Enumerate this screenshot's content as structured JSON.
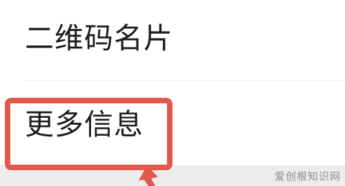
{
  "rows": [
    {
      "label": "二维码名片"
    },
    {
      "label": "更多信息"
    }
  ],
  "annotation": {
    "color": "#e2584a"
  },
  "watermark": "爱创根知识网"
}
